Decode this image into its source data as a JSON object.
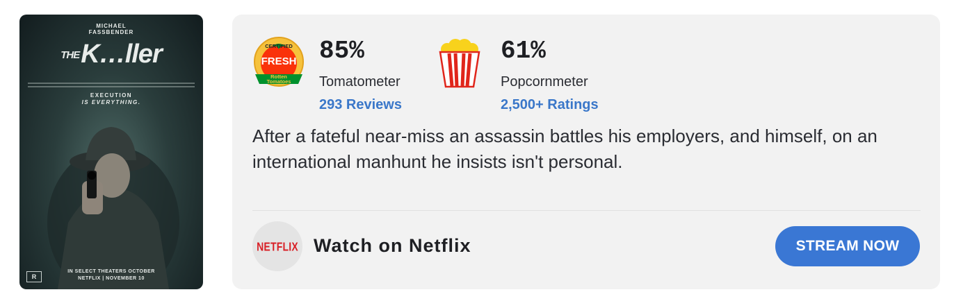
{
  "poster": {
    "actor_line1": "MICHAEL",
    "actor_line2": "FASSBENDER",
    "title_prefix": "THE",
    "title": "K…ller",
    "tagline_line1": "EXECUTION",
    "tagline_line2": "IS EVERYTHING.",
    "release_line1": "IN SELECT THEATERS OCTOBER",
    "release_line2": "NETFLIX | NOVEMBER 10",
    "rating": "R"
  },
  "tomatometer": {
    "score": "85%",
    "label": "Tomatometer",
    "reviews_link": "293 Reviews",
    "badge_top": "CERTIFIED",
    "badge_main": "FRESH",
    "badge_brand1": "Rotten",
    "badge_brand2": "Tomatoes",
    "icon": "certified-fresh-icon"
  },
  "popcornmeter": {
    "score": "61%",
    "label": "Popcornmeter",
    "ratings_link": "2,500+ Ratings",
    "icon": "popcorn-bucket-icon"
  },
  "synopsis": "After a fateful near-miss an assassin battles his employers, and himself, on an international manhunt he insists isn't personal.",
  "streaming": {
    "logo_text": "NETFLIX",
    "watch_label": "Watch on Netflix",
    "button_label": "STREAM NOW"
  },
  "colors": {
    "card_bg": "#f2f2f2",
    "link_blue": "#3a77c9",
    "button_blue": "#3a77d4",
    "netflix_red": "#d81f26"
  }
}
